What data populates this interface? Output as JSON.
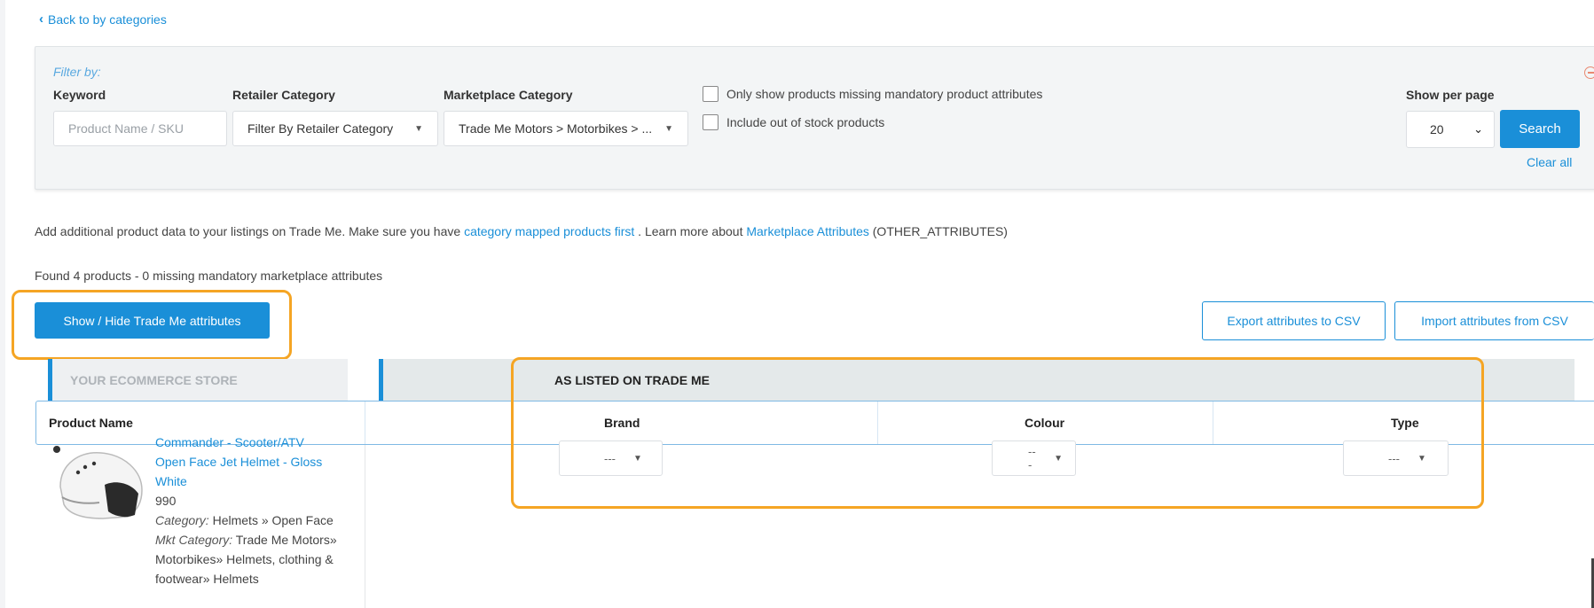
{
  "nav": {
    "back_label": "Back to by categories"
  },
  "filter": {
    "title": "Filter by:",
    "keyword_label": "Keyword",
    "keyword_placeholder": "Product Name / SKU",
    "retailer_label": "Retailer Category",
    "retailer_value": "Filter By Retailer Category",
    "marketplace_label": "Marketplace Category",
    "marketplace_value": "Trade Me Motors > Motorbikes > ...",
    "missing_label": "Only show products missing mandatory product attributes",
    "out_of_stock_label": "Include out of stock products",
    "per_page_label": "Show per page",
    "per_page_value": "20",
    "search_label": "Search",
    "clear_label": "Clear all"
  },
  "info": {
    "text1": "Add additional product data to your listings on Trade Me. Make sure you have ",
    "link1": "category mapped products first",
    "text2": " . Learn more about ",
    "link2": "Marketplace Attributes",
    "text3": " (OTHER_ATTRIBUTES)"
  },
  "found_text": "Found 4 products - 0 missing mandatory marketplace attributes",
  "actions": {
    "toggle_label": "Show / Hide Trade Me attributes",
    "export_label": "Export attributes to CSV",
    "import_label": "Import attributes from CSV"
  },
  "table": {
    "store_header": "YOUR ECOMMERCE STORE",
    "trade_header": "AS LISTED ON TRADE ME",
    "columns": [
      "Product Name",
      "Brand",
      "Colour",
      "Type"
    ],
    "rows": [
      {
        "name_partial": "Commander - Scooter/ATV",
        "name_line2": "Open Face Jet Helmet - Gloss",
        "name_line3": "White",
        "price": "990",
        "category_label": "Category:",
        "category": " Helmets » Open Face",
        "mkt_label": "Mkt Category:",
        "mkt_category": " Trade Me Motors» Motorbikes» Helmets, clothing & footwear» Helmets",
        "brand": "---",
        "colour": "---",
        "type": "---"
      }
    ]
  },
  "colors": {
    "accent": "#1a8fd8",
    "highlight": "#f5a524"
  }
}
